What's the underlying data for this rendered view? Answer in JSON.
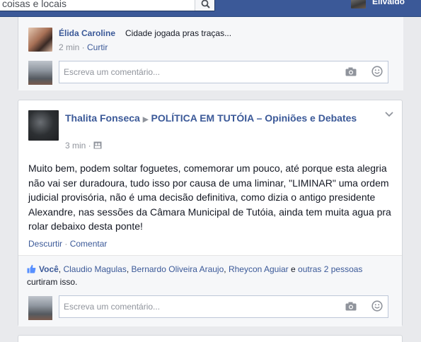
{
  "topbar": {
    "search_text": "coisas e locais",
    "user_name": "Elivaldo"
  },
  "comment": {
    "author": "Élida Caroline",
    "text": "Cidade jogada pras traças...",
    "time": "2 min",
    "action": "Curtir"
  },
  "reply_placeholder": "Escreva um comentário...",
  "post": {
    "author": "Thalita Fonseca",
    "group": "POLÍTICA EM TUTÓIA – Opiniões e Debates",
    "time": "3 min",
    "body": "Muito bem, podem soltar foguetes, comemorar um pouco, até porque esta alegria não vai ser duradoura, tudo isso por causa de uma liminar, \"LIMINAR\" uma ordem judicial provisória, não é uma decisão definitiva, como dizia o antigo presidente Alexandre, nas sessões da Câmara Municipal de Tutóia, ainda tem muita agua pra rolar debaixo desta ponte!",
    "actions": [
      "Descurtir",
      "Comentar"
    ],
    "likes": {
      "names": [
        "Você",
        "Claudio Magulas",
        "Bernardo Oliveira Araujo",
        "Rheycon Aguiar"
      ],
      "conjunction": "e",
      "others": "outras 2 pessoas",
      "suffix": "curtiram isso."
    }
  }
}
